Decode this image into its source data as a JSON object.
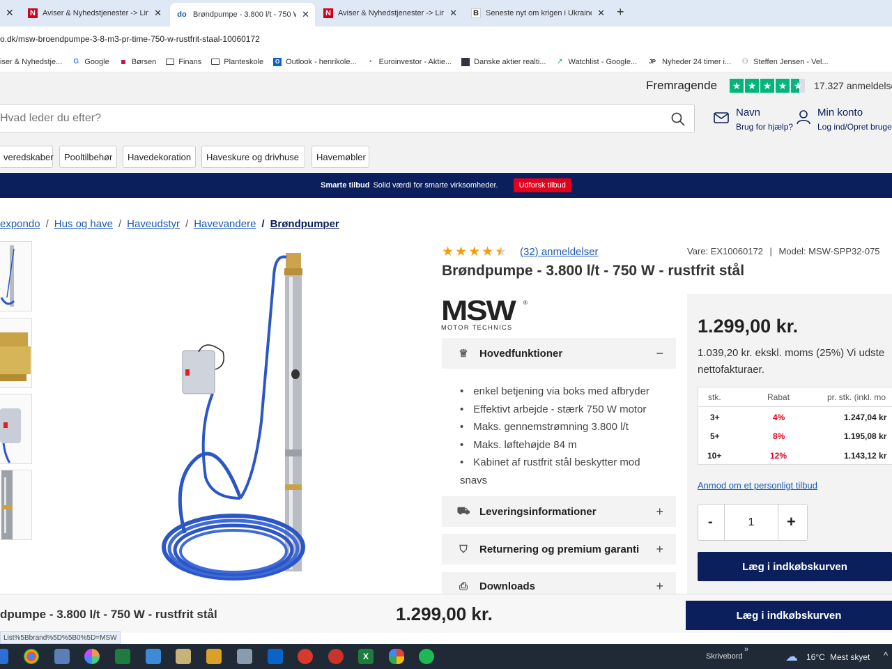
{
  "browser": {
    "tabs": [
      {
        "title": "Aviser & Nyhedstjenester -> Lin",
        "favicon": "N",
        "favcolor": "#d0021b"
      },
      {
        "title": "Brøndpumpe - 3.800 l/t - 750 W",
        "favicon": "do",
        "favcolor": "#1a5bb4"
      },
      {
        "title": "Aviser & Nyhedstjenester -> Lin",
        "favicon": "N",
        "favcolor": "#d0021b"
      },
      {
        "title": "Seneste nyt om krigen i Ukraine",
        "favicon": "B",
        "favcolor": "#222"
      }
    ],
    "url": "o.dk/msw-broendpumpe-3-8-m3-pr-time-750-w-rustfrit-staal-10060172",
    "bookmarks": [
      {
        "label": "iser & Nyhedstje...",
        "icon": "newspaper-icon"
      },
      {
        "label": "Google",
        "icon": "google-icon"
      },
      {
        "label": "Børsen",
        "icon": "borsen-icon"
      },
      {
        "label": "Finans",
        "icon": "folder-icon"
      },
      {
        "label": "Planteskole",
        "icon": "folder-icon"
      },
      {
        "label": "Outlook - henrikole...",
        "icon": "outlook-icon"
      },
      {
        "label": "Euroinvestor - Aktie...",
        "icon": "euroinvestor-icon"
      },
      {
        "label": "Danske aktier realti...",
        "icon": "stocks-icon"
      },
      {
        "label": "Watchlist - Google...",
        "icon": "watchlist-icon"
      },
      {
        "label": "Nyheder 24 timer i...",
        "icon": "jp-icon"
      },
      {
        "label": "Steffen Jensen - Vel...",
        "icon": "person-icon"
      }
    ]
  },
  "trust": {
    "label": "Fremragende",
    "reviews": "17.327 anmeldelse"
  },
  "header": {
    "search_placeholder": "Hvad leder du efter?",
    "contact_title": "Navn",
    "contact_sub": "Brug for hjælp?",
    "account_title": "Min konto",
    "account_sub": "Log ind/Opret bruger"
  },
  "categories": [
    "veredskaber",
    "Pooltilbehør",
    "Havedekoration",
    "Haveskure og drivhuse",
    "Havemøbler"
  ],
  "promo": {
    "bold": "Smarte tilbud",
    "text": "Solid værdi for smarte virksomheder.",
    "button": "Udforsk tilbud"
  },
  "breadcrumb": [
    "expondo",
    "Hus og have",
    "Haveudstyr",
    "Havevandere",
    "Brøndpumper"
  ],
  "product": {
    "rating": 4.5,
    "reviews_link": "(32) anmeldelser",
    "item_no": "Vare: EX10060172",
    "model": "Model: MSW-SPP32-075",
    "title": "Brøndpumpe - 3.800 l/t - 750 W - rustfrit stål",
    "brand_main": "MSW",
    "brand_sub": "MOTOR TECHNICS",
    "sections": {
      "main": "Hovedfunktioner",
      "delivery": "Leveringsinformationer",
      "returns": "Returnering og premium garanti",
      "downloads": "Downloads"
    },
    "features": [
      "enkel betjening via boks med afbryder",
      "Effektivt arbejde - stærk 750 W motor",
      "Maks. gennemstrømning 3.800 l/t",
      "Maks. løftehøjde 84 m",
      "Kabinet af rustfrit stål beskytter mod",
      "snavs"
    ]
  },
  "pricing": {
    "price": "1.299,00 kr.",
    "ex_vat_line1": "1.039,20 kr. ekskl. moms (25%) Vi udste",
    "ex_vat_line2": "nettofakturaer.",
    "table_headers": [
      "stk.",
      "Rabat",
      "pr. stk. (inkl. mo"
    ],
    "tiers": [
      {
        "qty": "3+",
        "discount": "4%",
        "price": "1.247,04 kr"
      },
      {
        "qty": "5+",
        "discount": "8%",
        "price": "1.195,08 kr"
      },
      {
        "qty": "10+",
        "discount": "12%",
        "price": "1.143,12 kr"
      }
    ],
    "offer_link": "Anmod om et personligt tilbud",
    "quantity": "1",
    "minus": "-",
    "plus": "+",
    "add_to_cart": "Læg i indkøbskurven"
  },
  "sticky": {
    "title": "dpumpe - 3.800 l/t - 750 W - rustfrit stål",
    "price": "1.299,00 kr.",
    "add_to_cart": "Læg i indkøbskurven"
  },
  "status_url": "List%5Bbrand%5D%5B0%5D=MSW",
  "taskbar": {
    "desktop_label": "Skrivebord",
    "weather_temp": "16°C",
    "weather_desc": "Mest skyet"
  }
}
